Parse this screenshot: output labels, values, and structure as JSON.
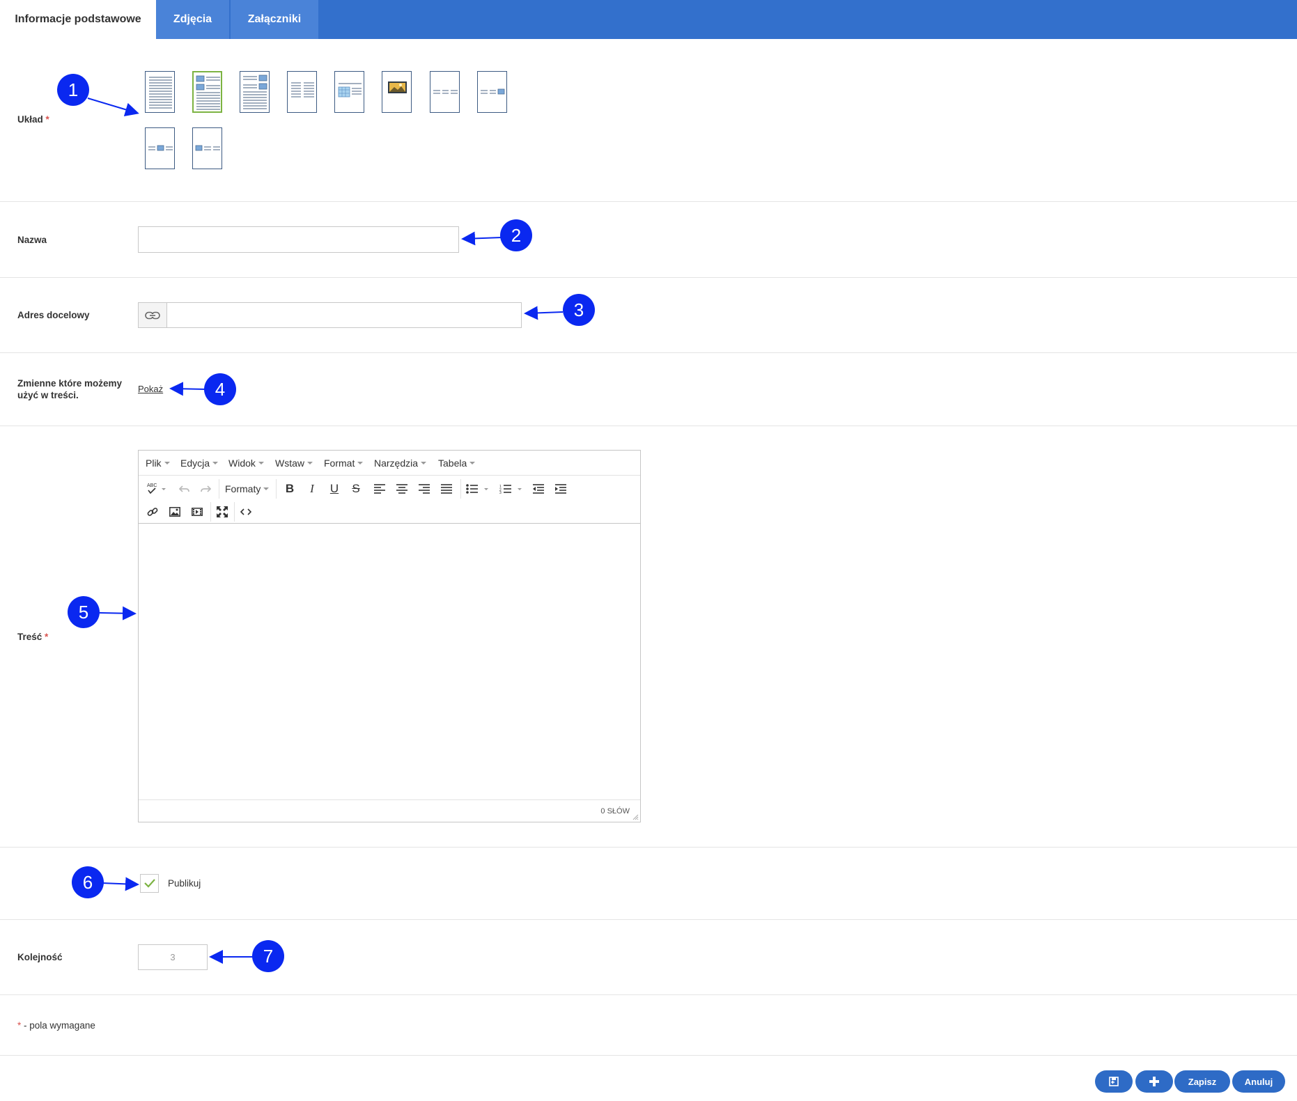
{
  "tabs": [
    {
      "label": "Informacje podstawowe",
      "active": true
    },
    {
      "label": "Zdjęcia",
      "active": false
    },
    {
      "label": "Załączniki",
      "active": false
    }
  ],
  "fields": {
    "layout": {
      "label": "Układ",
      "required_mark": "*",
      "selected_index": 1,
      "options_count": 10
    },
    "name": {
      "label": "Nazwa",
      "value": ""
    },
    "target_url": {
      "label": "Adres docelowy",
      "value": "",
      "icon": "link-icon"
    },
    "variables": {
      "label_line1": "Zmienne które możemy",
      "label_line2": "użyć w treści.",
      "link": "Pokaż"
    },
    "content": {
      "label": "Treść",
      "required_mark": "*"
    },
    "publish": {
      "label": "Publikuj",
      "checked": true
    },
    "order": {
      "label": "Kolejność",
      "value": "3"
    }
  },
  "editor": {
    "menus": [
      "Plik",
      "Edycja",
      "Widok",
      "Wstaw",
      "Format",
      "Narzędzia",
      "Tabela"
    ],
    "formats_label": "Formaty",
    "word_count": "0 SŁÓW"
  },
  "footer_note": {
    "mark": "*",
    "text": "- pola wymagane"
  },
  "buttons": {
    "save": "Zapisz",
    "cancel": "Anuluj",
    "save_back_icon": "save-and-return-icon",
    "add_icon": "plus-icon"
  },
  "markers": [
    "1",
    "2",
    "3",
    "4",
    "5",
    "6",
    "7"
  ],
  "colors": {
    "tabbar": "#3370cc",
    "marker": "#0a28f0",
    "button": "#2e6bc6",
    "selected_thumb": "#7cb342",
    "required": "#d9534f"
  }
}
